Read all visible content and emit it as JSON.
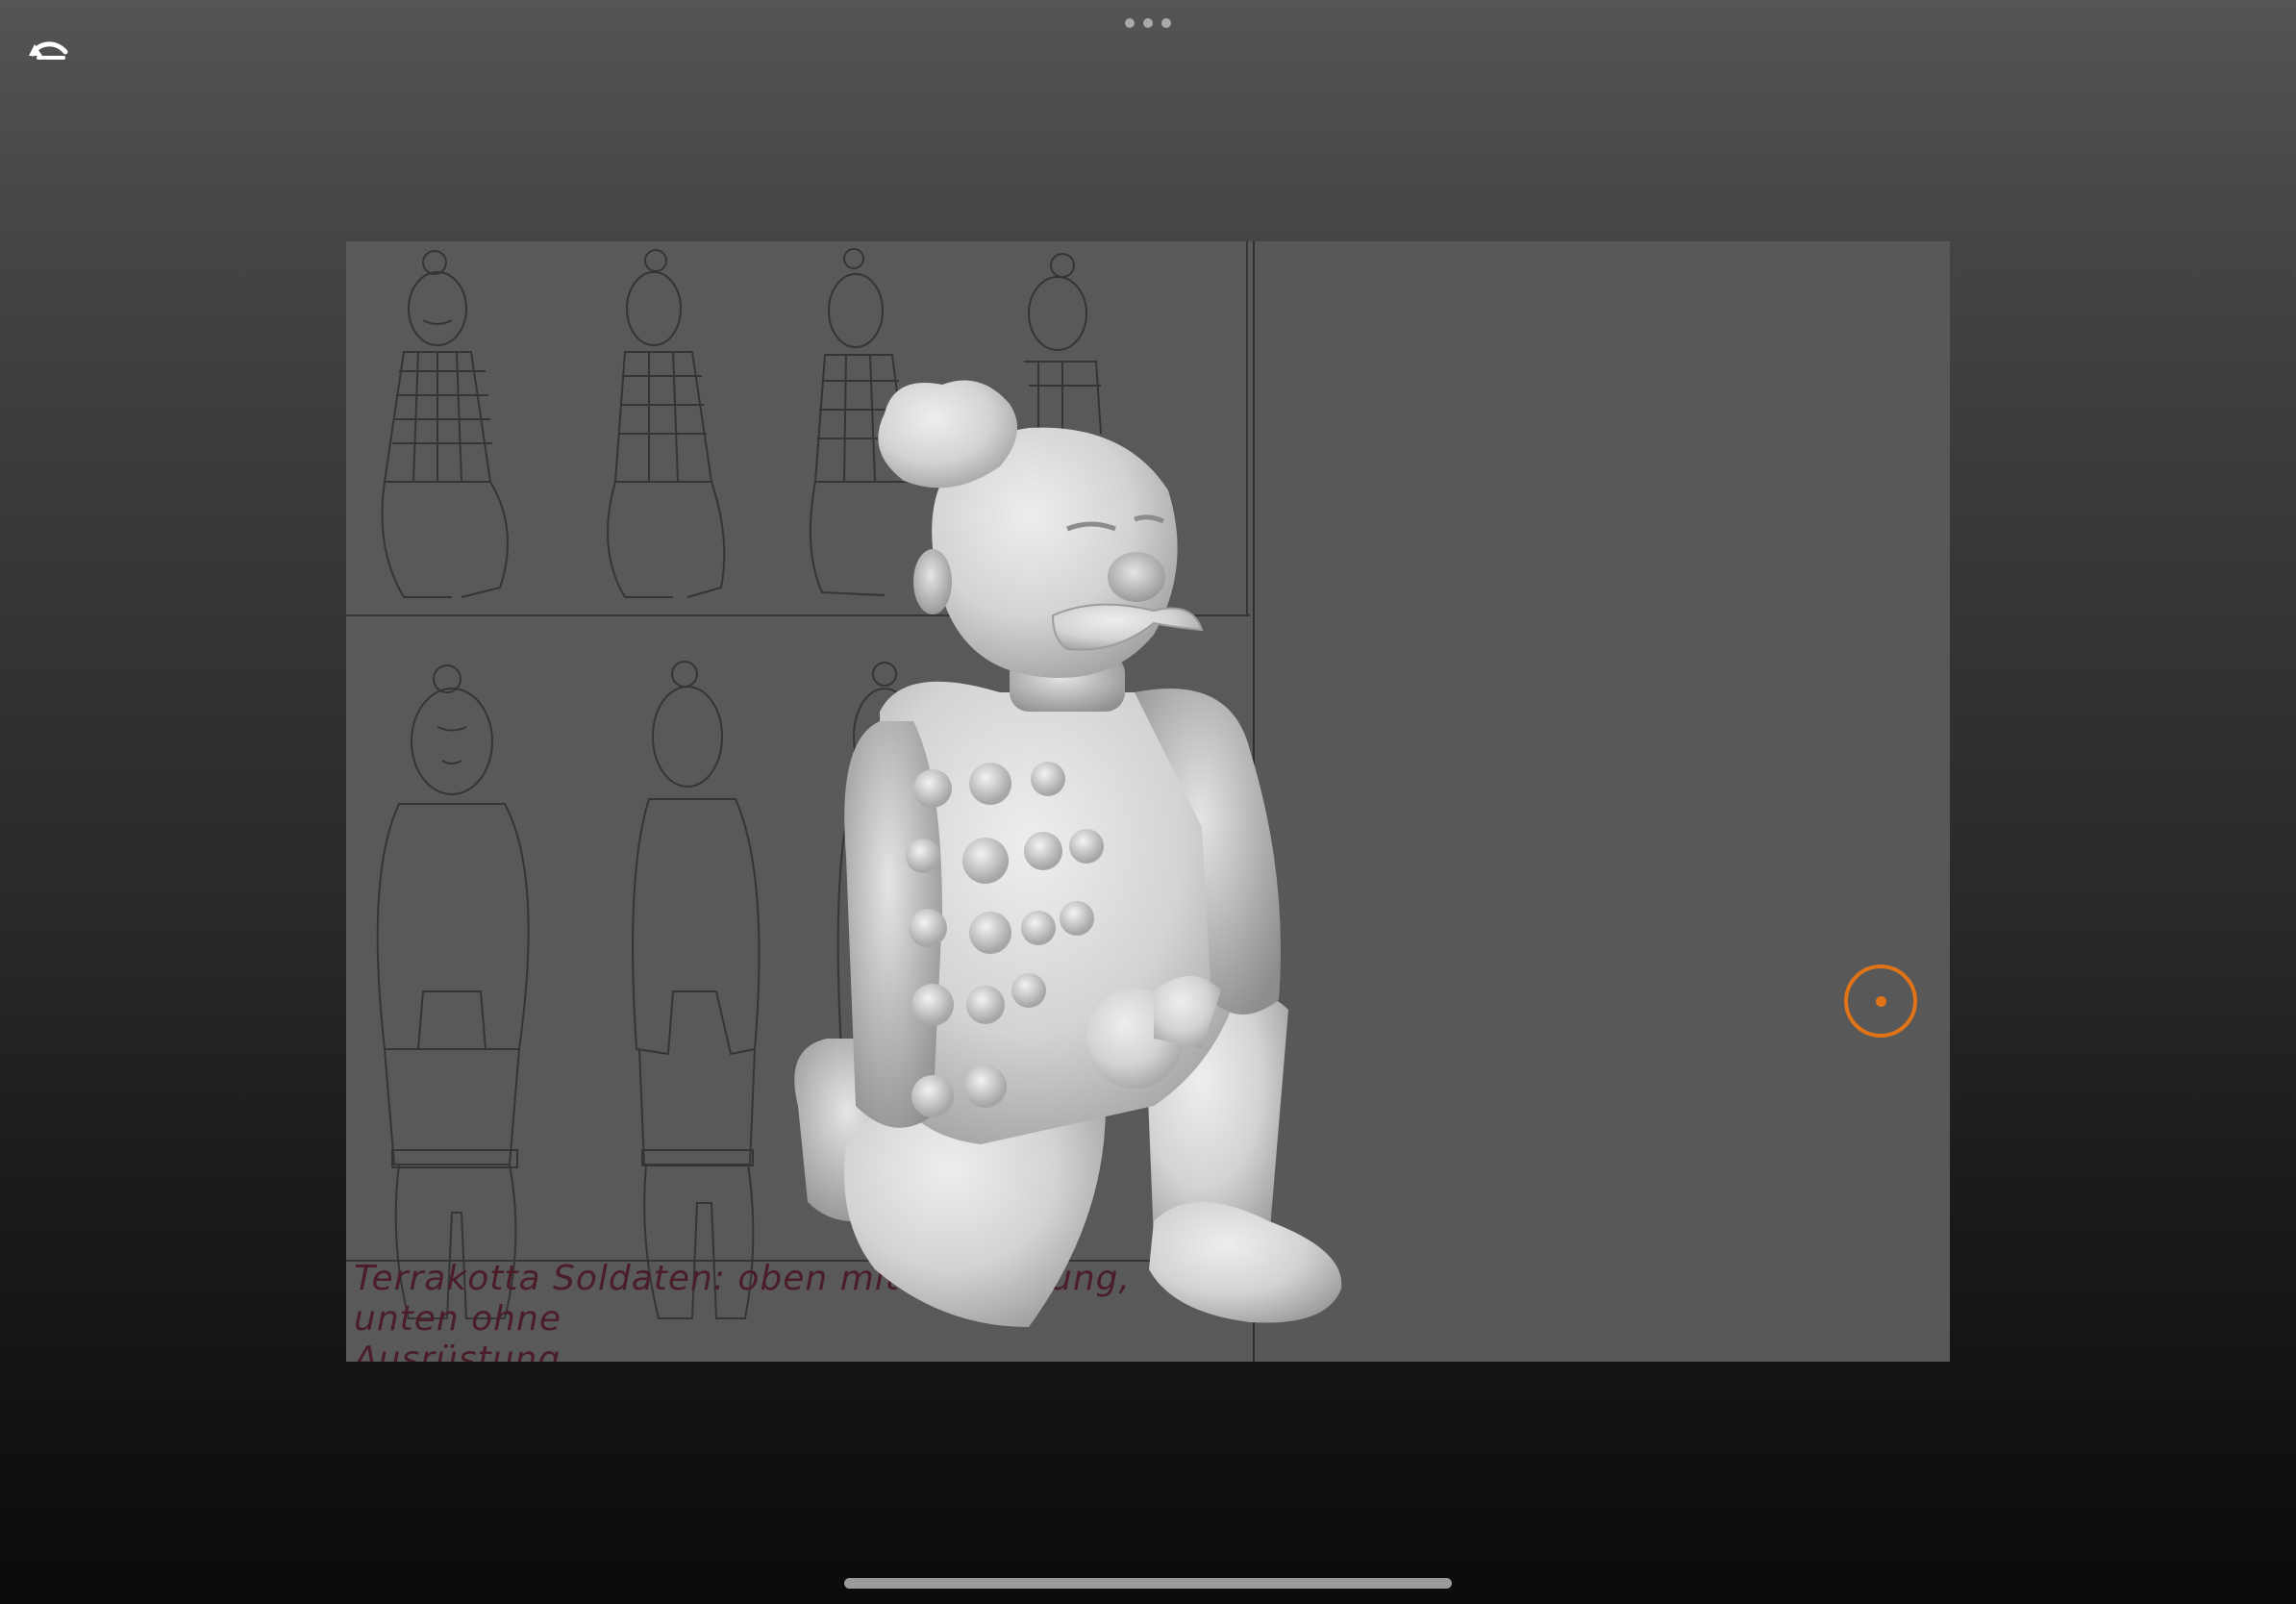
{
  "top_bar": {
    "multitask_icon": "ellipsis-icon",
    "undo_icon": "undo-arrow-icon"
  },
  "reference_sheet": {
    "caption_line1": "Terrakotta Soldaten: oben mit Ausrüstung, unten ohne",
    "caption_line2": "Ausrüstung",
    "caption_color": "#4a1d28"
  },
  "model": {
    "subject": "kneeling terracotta warrior sculpt",
    "material_color": "#d8d6d4"
  },
  "pivot": {
    "icon": "pivot-target-icon",
    "color": "#e07318"
  },
  "system": {
    "home_indicator_icon": "home-indicator"
  }
}
